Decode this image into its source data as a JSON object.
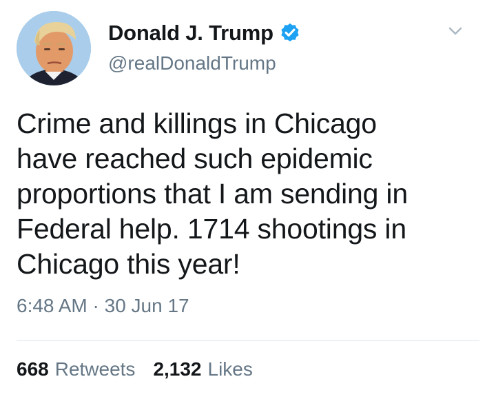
{
  "tweet": {
    "display_name": "Donald J. Trump",
    "handle": "@realDonaldTrump",
    "verified": true,
    "text": "Crime and killings in Chicago\nhave reached such epidemic\nproportions that I am sending in\nFederal help. 1714 shootings in\nChicago this year!",
    "time": "6:48 AM",
    "separator": "·",
    "date": "30 Jun 17",
    "retweets_count": "668",
    "retweets_label": "Retweets",
    "likes_count": "2,132",
    "likes_label": "Likes"
  },
  "icons": {
    "verified": "verified-badge-icon",
    "menu": "chevron-down-icon"
  },
  "colors": {
    "primary_text": "#14171a",
    "secondary_text": "#657786",
    "verified_blue": "#1da1f2",
    "divider": "#e1e8ed"
  }
}
